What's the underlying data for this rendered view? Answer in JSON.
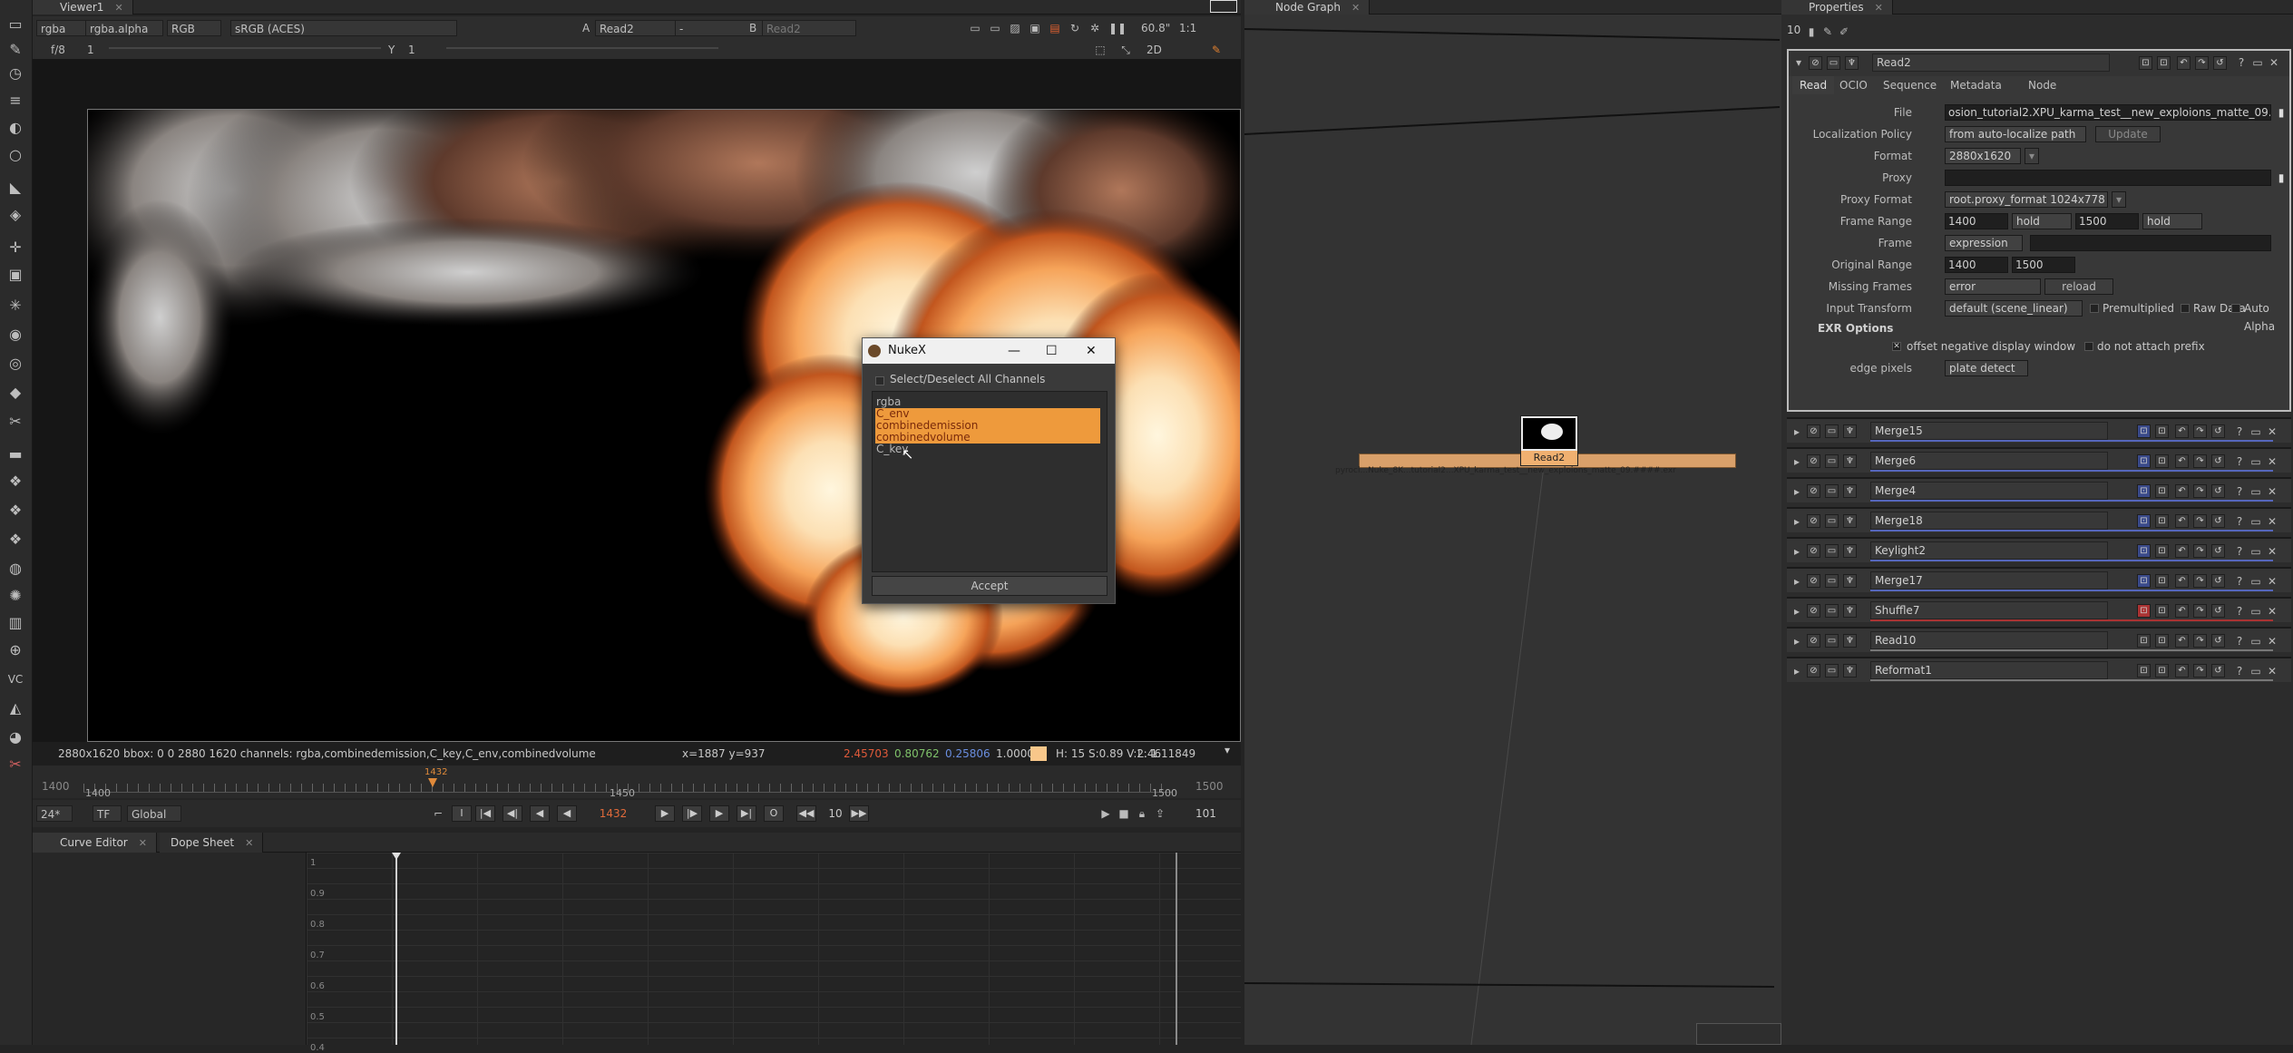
{
  "app": {
    "name": "NukeX"
  },
  "viewer": {
    "tab_label": "Viewer1",
    "channels": "rgba",
    "alpha_channel": "rgba.alpha",
    "display_mode": "RGB",
    "colorspace": "sRGB (ACES)",
    "input_a_label": "A",
    "input_a": "Read2",
    "wipe_mode": "-",
    "input_b_label": "B",
    "input_b": "Read2",
    "gain": "60.8\"",
    "zoom": "1:1",
    "fstop": "f/8",
    "frame_field": "1",
    "y_label": "Y",
    "y_field": "1",
    "view_mode": "2D"
  },
  "statusbar": {
    "info": "2880x1620  bbox: 0 0 2880 1620 channels: rgba,combinedemission,C_key,C_env,combinedvolume",
    "coords": "x=1887 y=937",
    "r": "2.45703",
    "g": "0.80762",
    "b": "0.25806",
    "a": "1.00000",
    "swatch_color": "#f8c78a",
    "hsv": "H: 15 S:0.89 V:2.46",
    "luma": "L: 1.11849"
  },
  "timeline": {
    "start": "1400",
    "mid": "1450",
    "end": "1500",
    "current": "1432",
    "range_start_dim": "1400",
    "range_end_dim": "1500",
    "current_fraction": 0.32
  },
  "transport": {
    "fps": "24*",
    "tf": "TF",
    "scope": "Global",
    "frame": "1432",
    "step": "10",
    "end_frame": "101",
    "buttons": [
      "|◀",
      "◀|",
      "◀",
      "◀",
      "▶",
      "|▶",
      "▶",
      "▶|"
    ]
  },
  "curve_editor": {
    "tab1": "Curve Editor",
    "tab2": "Dope Sheet",
    "y_ticks": [
      "1",
      "0.9",
      "0.8",
      "0.7",
      "0.6",
      "0.5",
      "0.4"
    ]
  },
  "nodegraph": {
    "tab_label": "Node Graph",
    "node_label": "Read2",
    "node_path": "pyrocl...Nuke_8K...tutorial2...XPU_karma_test__new_exploions_matte_09.####.exr"
  },
  "dialog": {
    "title": "NukeX",
    "select_all": "Select/Deselect All Channels",
    "channels": [
      {
        "name": "rgba",
        "selected": false
      },
      {
        "name": "C_env",
        "selected": true
      },
      {
        "name": "combinedemission",
        "selected": true
      },
      {
        "name": "combinedvolume",
        "selected": true
      },
      {
        "name": "C_key",
        "selected": false
      }
    ],
    "accept": "Accept"
  },
  "properties": {
    "tab_label": "Properties",
    "max_panels": "10",
    "node_name": "Read2",
    "tabs": [
      "Read",
      "OCIO",
      "Sequence",
      "Metadata",
      "Node"
    ],
    "file_label": "File",
    "file_value": "osion_tutorial2.XPU_karma_test__new_exploions_matte_09.####.exr",
    "localization_label": "Localization Policy",
    "localization_value": "from auto-localize path",
    "update_btn": "Update",
    "format_label": "Format",
    "format_value": "2880x1620",
    "proxy_label": "Proxy",
    "proxy_format_label": "Proxy Format",
    "proxy_format_value": "root.proxy_format 1024x778",
    "frame_range_label": "Frame Range",
    "frame_range_start": "1400",
    "frame_range_before": "hold",
    "frame_range_end": "1500",
    "frame_range_after": "hold",
    "frame_label": "Frame",
    "frame_value": "expression",
    "original_range_label": "Original Range",
    "original_start": "1400",
    "original_end": "1500",
    "missing_frames_label": "Missing Frames",
    "missing_frames_value": "error",
    "reload_btn": "reload",
    "input_transform_label": "Input Transform",
    "input_transform_value": "default (scene_linear)",
    "premultiplied": "Premultiplied",
    "raw_data": "Raw Data",
    "auto_alpha": "Auto Alpha",
    "exr_options": "EXR Options",
    "offset_negative": "offset negative display window",
    "no_prefix": "do not attach prefix",
    "edge_pixels_label": "edge pixels",
    "edge_pixels_value": "plate detect"
  },
  "node_list": [
    {
      "name": "Merge15",
      "accent": "#5566bb"
    },
    {
      "name": "Merge6",
      "accent": "#5566bb"
    },
    {
      "name": "Merge4",
      "accent": "#5566bb"
    },
    {
      "name": "Merge18",
      "accent": "#5566bb"
    },
    {
      "name": "Keylight2",
      "accent": "#5566bb"
    },
    {
      "name": "Merge17",
      "accent": "#5566bb"
    },
    {
      "name": "Shuffle7",
      "accent": "#aa3333"
    },
    {
      "name": "Read10",
      "accent": "#777777"
    },
    {
      "name": "Reformat1",
      "accent": "#777777"
    }
  ]
}
